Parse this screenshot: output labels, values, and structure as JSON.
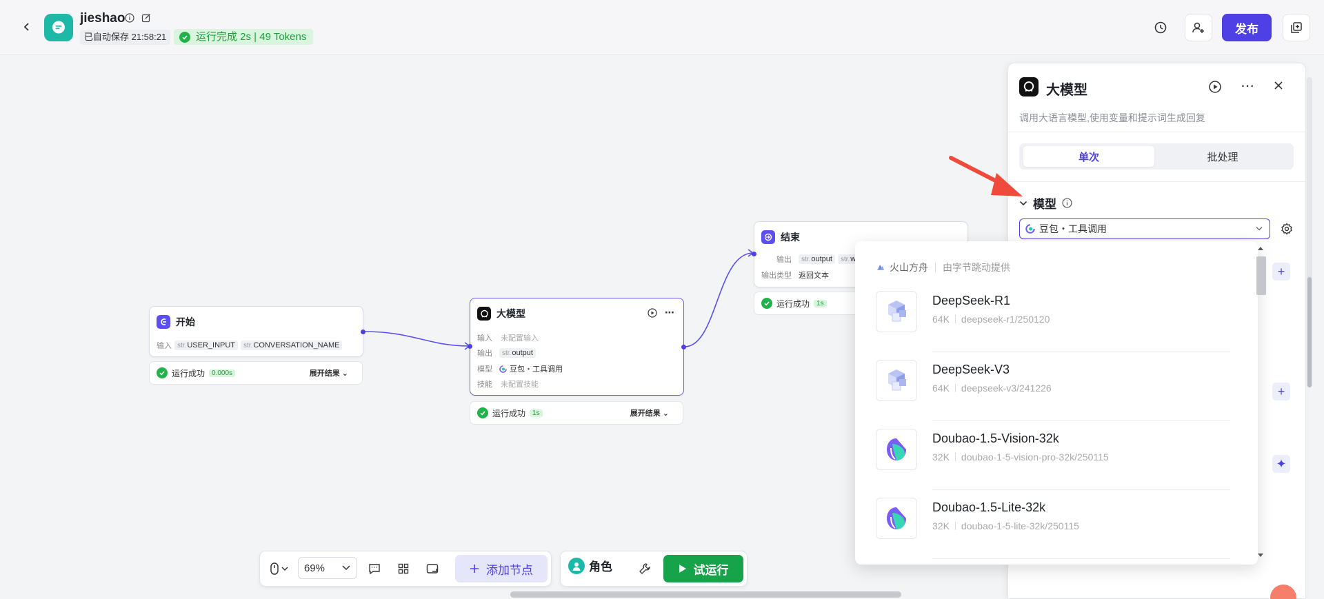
{
  "header": {
    "app_name": "jieshao",
    "autosave": "已自动保存 21:58:21",
    "run_status": "运行完成 2s | 49 Tokens",
    "publish": "发布"
  },
  "nodes": {
    "start": {
      "title": "开始",
      "input_label": "输入",
      "inputs": [
        {
          "prefix": "str.",
          "name": "USER_INPUT"
        },
        {
          "prefix": "str.",
          "name": "CONVERSATION_NAME"
        }
      ],
      "status": "运行成功",
      "time": "0.000s",
      "expand": "展开结果"
    },
    "llm": {
      "title": "大模型",
      "input_label": "输入",
      "input_value": "未配置输入",
      "output_label": "输出",
      "output_prefix": "str.",
      "output_name": "output",
      "model_label": "模型",
      "model_value": "豆包・工具调用",
      "skill_label": "技能",
      "skill_value": "未配置技能",
      "status": "运行成功",
      "time": "1s",
      "expand": "展开结果"
    },
    "end": {
      "title": "结束",
      "output_label": "输出",
      "outputs": [
        {
          "prefix": "str.",
          "name": "output"
        },
        {
          "prefix": "str.",
          "name": "w"
        }
      ],
      "output_type_label": "输出类型",
      "output_type": "返回文本",
      "status": "运行成功",
      "time": "1s"
    }
  },
  "toolbar": {
    "zoom": "69%",
    "add_node": "添加节点",
    "role": "角色",
    "trial_run": "试运行"
  },
  "panel": {
    "title": "大模型",
    "description": "调用大语言模型,使用变量和提示词生成回复",
    "tabs": [
      "单次",
      "批处理"
    ],
    "active_tab": "单次",
    "section_title": "模型",
    "selected_model": "豆包・工具调用"
  },
  "dropdown": {
    "provider": "火山方舟",
    "provider_by": "由字节跳动提供",
    "models": [
      {
        "name": "DeepSeek-R1",
        "context": "64K",
        "id": "deepseek-r1/250120",
        "logo": "cube-icon"
      },
      {
        "name": "DeepSeek-V3",
        "context": "64K",
        "id": "deepseek-v3/241226",
        "logo": "cube-icon"
      },
      {
        "name": "Doubao-1.5-Vision-32k",
        "context": "32K",
        "id": "doubao-1-5-vision-pro-32k/250115",
        "logo": "doubao-icon"
      },
      {
        "name": "Doubao-1.5-Lite-32k",
        "context": "32K",
        "id": "doubao-1-5-lite-32k/250115",
        "logo": "doubao-icon"
      }
    ]
  },
  "colors": {
    "accent": "#4e40e5",
    "success": "#21b249",
    "app_icon": "#1eb8a6",
    "trial_run": "#16a34a",
    "arrow": "#f04a3c"
  }
}
